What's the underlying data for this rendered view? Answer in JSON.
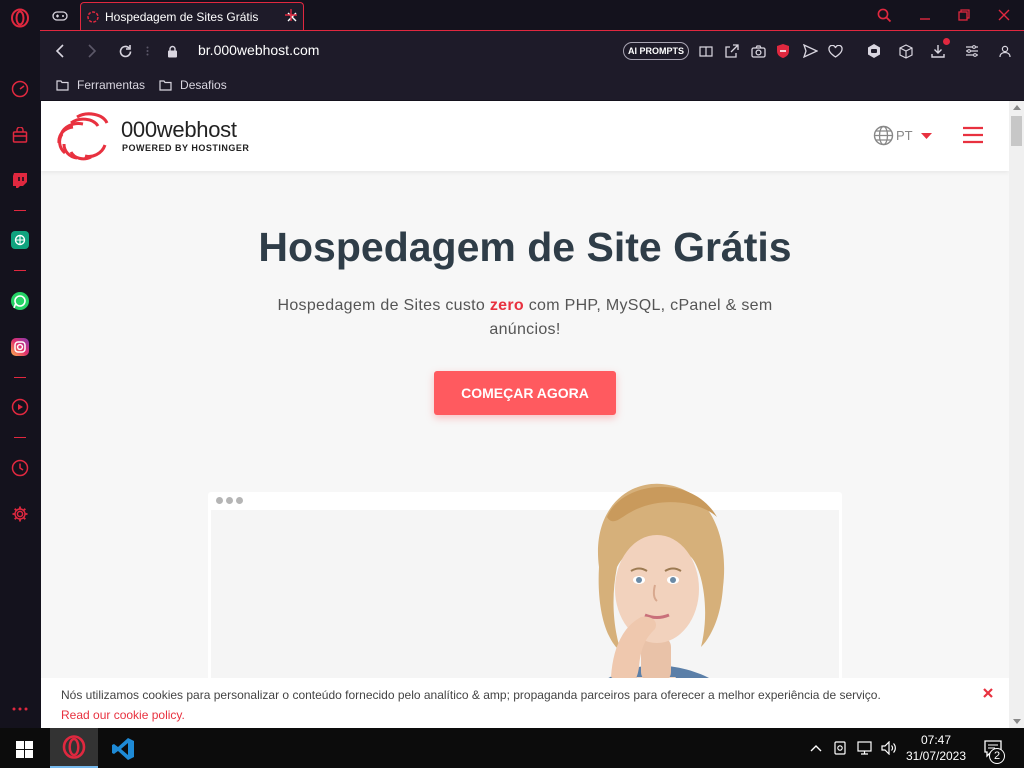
{
  "browser": {
    "tab_title": "Hospedagem de Sites Grátis",
    "url": "br.000webhost.com",
    "ai_prompts_label": "AI PROMPTS",
    "bookmarks": [
      {
        "label": "Ferramentas",
        "icon": "folder-icon"
      },
      {
        "label": "Desafios",
        "icon": "folder-icon"
      }
    ]
  },
  "page": {
    "logo_name": "000webhost",
    "logo_tagline": "POWERED BY HOSTINGER",
    "lang": "PT",
    "hero_title": "Hospedagem de Site Grátis",
    "hero_sub_before": "Hospedagem de Sites custo ",
    "hero_sub_highlight": "zero",
    "hero_sub_after": " com PHP, MySQL, cPanel & sem anúncios!",
    "cta_label": "COMEÇAR AGORA"
  },
  "cookie": {
    "text": "Nós utilizamos cookies para personalizar o conteúdo fornecido pelo analítico & amp; propaganda parceiros para oferecer a melhor experiência de serviço.",
    "link": "Read our cookie policy."
  },
  "taskbar": {
    "time": "07:47",
    "date": "31/07/2023",
    "notifications": "2"
  },
  "colors": {
    "accent": "#e0283f",
    "brand": "#ff5a5f",
    "heading": "#2f3d48"
  }
}
